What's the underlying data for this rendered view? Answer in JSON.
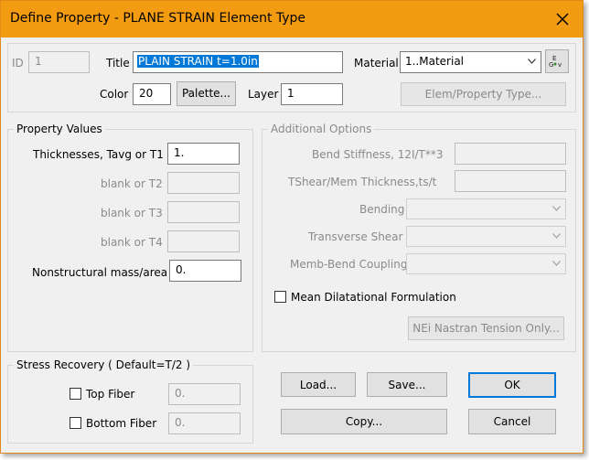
{
  "window": {
    "title": "Define Property - PLANE STRAIN Element Type"
  },
  "header": {
    "id_label": "ID",
    "id_value": "1",
    "title_label": "Title",
    "title_value": "PLAIN STRAIN t=1.0in",
    "material_label": "Material",
    "material_value": "1..Material",
    "color_label": "Color",
    "color_value": "20",
    "palette_button": "Palette...",
    "layer_label": "Layer",
    "layer_value": "1",
    "elem_property_type_button": "Elem/Property Type..."
  },
  "property_values": {
    "title": "Property Values",
    "t1_label": "Thicknesses, Tavg or T1",
    "t1_value": "1.",
    "t2_label": "blank or T2",
    "t3_label": "blank or T3",
    "t4_label": "blank or T4",
    "nsm_label": "Nonstructural mass/area",
    "nsm_value": "0."
  },
  "additional_options": {
    "title": "Additional Options",
    "bend_stiffness_label": "Bend Stiffness,  12I/T**3",
    "tshear_label": "TShear/Mem Thickness,ts/t",
    "bending_label": "Bending",
    "transverse_shear_label": "Transverse Shear",
    "memb_bend_label": "Memb-Bend Coupling",
    "mean_dilatational_label": "Mean Dilatational Formulation",
    "nei_button": "NEi Nastran Tension Only..."
  },
  "stress_recovery": {
    "title": "Stress Recovery ( Default=T/2 )",
    "top_fiber_label": "Top Fiber",
    "top_fiber_value": "0.",
    "bottom_fiber_label": "Bottom Fiber",
    "bottom_fiber_value": "0."
  },
  "buttons": {
    "load": "Load...",
    "save": "Save...",
    "ok": "OK",
    "copy": "Copy...",
    "cancel": "Cancel"
  },
  "colors": {
    "titlebar": "#f39c12",
    "selection": "#0078d7"
  }
}
